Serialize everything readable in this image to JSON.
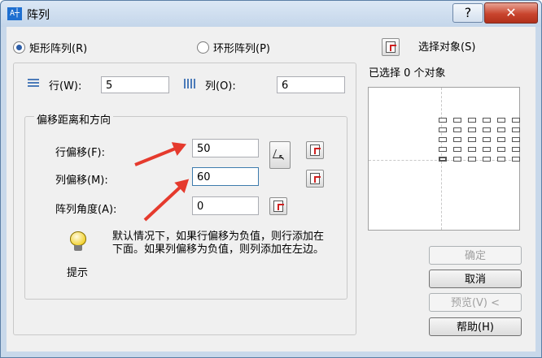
{
  "window": {
    "title": "阵列",
    "app_icon_text": "A┼",
    "help_label": "?",
    "close_label": "✕"
  },
  "mode": {
    "rect_label": "矩形阵列(R)",
    "polar_label": "环形阵列(P)",
    "selected": "rect"
  },
  "rows": {
    "label": "行(W):",
    "value": "5"
  },
  "cols": {
    "label": "列(O):",
    "value": "6"
  },
  "offset_group": {
    "title": "偏移距离和方向",
    "row_offset_label": "行偏移(F):",
    "row_offset_value": "50",
    "col_offset_label": "列偏移(M):",
    "col_offset_value": "60",
    "angle_label": "阵列角度(A):",
    "angle_value": "0"
  },
  "tip": {
    "label": "提示",
    "text": "默认情况下，如果行偏移为负值，则行添加在下面。如果列偏移为负值，则列添加在左边。"
  },
  "select": {
    "button_label": "选择对象(S)",
    "status": "已选择 0 个对象"
  },
  "buttons": {
    "ok": "确定",
    "cancel": "取消",
    "preview": "预览(V) <",
    "help": "帮助(H)"
  },
  "preview_grid": {
    "rows": 5,
    "cols": 6
  },
  "colors": {
    "accent": "#2d5ea8",
    "annotation_arrow": "#e53a2d"
  }
}
